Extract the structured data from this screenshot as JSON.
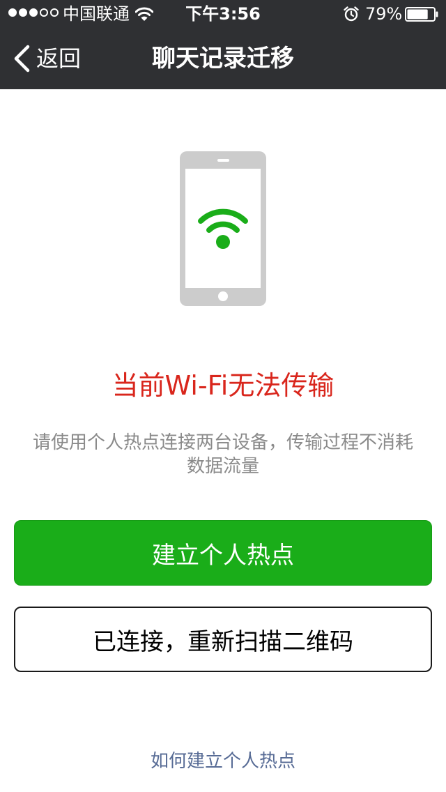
{
  "status_bar": {
    "carrier": "中国联通",
    "time": "下午3:56",
    "battery_percent": "79%",
    "battery_level": 0.79,
    "signal_strength": 3,
    "signal_max": 5
  },
  "nav": {
    "back_label": "返回",
    "title": "聊天记录迁移"
  },
  "main": {
    "warning_title": "当前Wi-Fi无法传输",
    "description": "请使用个人热点连接两台设备，传输过程不消耗数据流量",
    "primary_button_label": "建立个人热点",
    "secondary_button_label": "已连接，重新扫描二维码",
    "help_link_label": "如何建立个人热点"
  },
  "icons": {
    "back": "chevron-left-icon",
    "status_wifi": "wifi-icon",
    "alarm": "alarm-clock-icon",
    "battery": "battery-icon",
    "phone": "phone-icon",
    "phone_wifi": "wifi-icon"
  },
  "colors": {
    "nav_background": "#2f3033",
    "accent_green": "#1aad19",
    "warning_red": "#d9261c",
    "link_blue": "#576b95",
    "text_gray": "#8a8a8a",
    "phone_gray": "#cccccc"
  }
}
